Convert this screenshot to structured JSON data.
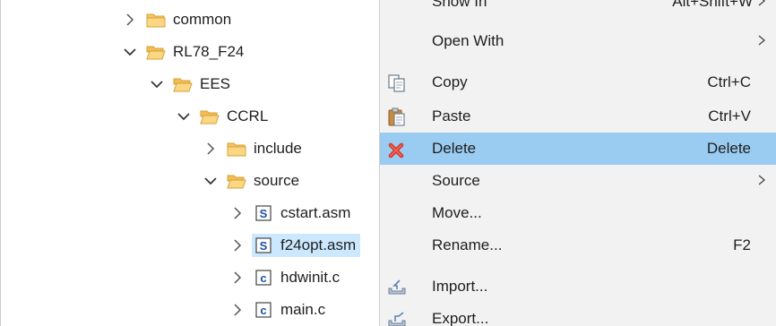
{
  "tree": {
    "items": [
      {
        "label": "common",
        "expanded": false,
        "icon": "folder-icon"
      },
      {
        "label": "RL78_F24",
        "expanded": true,
        "icon": "folder-open-icon"
      },
      {
        "label": "EES",
        "expanded": true,
        "icon": "folder-open-icon"
      },
      {
        "label": "CCRL",
        "expanded": true,
        "icon": "folder-open-icon"
      },
      {
        "label": "include",
        "expanded": false,
        "icon": "folder-icon"
      },
      {
        "label": "source",
        "expanded": true,
        "icon": "folder-open-icon"
      },
      {
        "label": "cstart.asm",
        "expanded": false,
        "icon": "asm-file-icon"
      },
      {
        "label": "f24opt.asm",
        "expanded": false,
        "icon": "asm-file-icon",
        "selected": true
      },
      {
        "label": "hdwinit.c",
        "expanded": false,
        "icon": "c-file-icon"
      },
      {
        "label": "main.c",
        "expanded": false,
        "icon": "c-file-icon"
      }
    ]
  },
  "menu": {
    "items": [
      {
        "label": "Show In",
        "shortcut": "Alt+Shift+W",
        "submenu": true,
        "icon": ""
      },
      {
        "label": "Open With",
        "shortcut": "",
        "submenu": true,
        "icon": ""
      },
      {
        "label": "Copy",
        "shortcut": "Ctrl+C",
        "submenu": false,
        "icon": "copy-icon"
      },
      {
        "label": "Paste",
        "shortcut": "Ctrl+V",
        "submenu": false,
        "icon": "paste-icon"
      },
      {
        "label": "Delete",
        "shortcut": "Delete",
        "submenu": false,
        "icon": "delete-icon",
        "highlighted": true
      },
      {
        "label": "Source",
        "shortcut": "",
        "submenu": true,
        "icon": ""
      },
      {
        "label": "Move...",
        "shortcut": "",
        "submenu": false,
        "icon": ""
      },
      {
        "label": "Rename...",
        "shortcut": "F2",
        "submenu": false,
        "icon": ""
      },
      {
        "label": "Import...",
        "shortcut": "",
        "submenu": false,
        "icon": "import-icon"
      },
      {
        "label": "Export...",
        "shortcut": "",
        "submenu": false,
        "icon": "export-icon"
      }
    ]
  },
  "colors": {
    "highlight": "#99ccf0",
    "selection": "#cce8ff",
    "menu_bg": "#f2f2f2",
    "folder": "#f5c15a",
    "delete_red": "#d8322a"
  }
}
